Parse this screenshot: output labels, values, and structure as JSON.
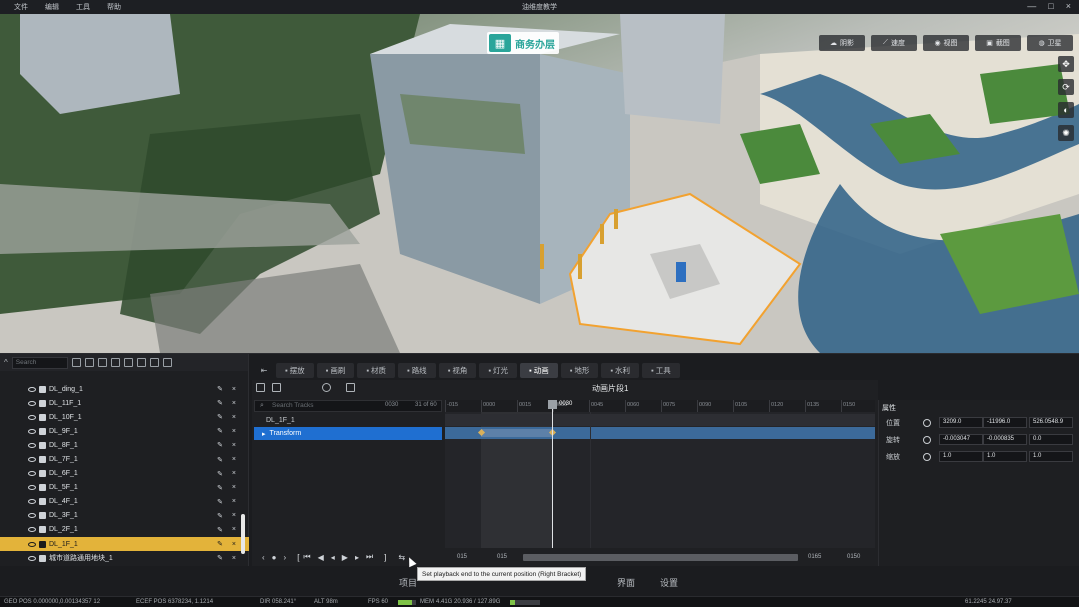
{
  "menubar": {
    "items": [
      "文件",
      "编辑",
      "工具",
      "帮助"
    ],
    "title": "油维度教学",
    "window_controls": [
      "—",
      "□",
      "×"
    ]
  },
  "viewport": {
    "floor_badge": "商务办层",
    "toolbar": [
      {
        "icon": "cloud-icon",
        "label": "阴影"
      },
      {
        "icon": "chart-icon",
        "label": "速度"
      },
      {
        "icon": "eye-icon",
        "label": "视图"
      },
      {
        "icon": "image-icon",
        "label": "截图"
      },
      {
        "icon": "globe-icon",
        "label": "卫星"
      }
    ],
    "side_buttons": [
      "move-icon",
      "rotate-icon",
      "orbit-icon",
      "compass-icon"
    ]
  },
  "tree": {
    "search_placeholder": "Search",
    "items": [
      {
        "name": "DL_ding_1",
        "selected": false
      },
      {
        "name": "DL_11F_1",
        "selected": false
      },
      {
        "name": "DL_10F_1",
        "selected": false
      },
      {
        "name": "DL_9F_1",
        "selected": false
      },
      {
        "name": "DL_8F_1",
        "selected": false
      },
      {
        "name": "DL_7F_1",
        "selected": false
      },
      {
        "name": "DL_6F_1",
        "selected": false
      },
      {
        "name": "DL_5F_1",
        "selected": false
      },
      {
        "name": "DL_4F_1",
        "selected": false
      },
      {
        "name": "DL_3F_1",
        "selected": false
      },
      {
        "name": "DL_2F_1",
        "selected": false
      },
      {
        "name": "DL_1F_1",
        "selected": true
      },
      {
        "name": "城市道路通用地块_1",
        "selected": false
      }
    ]
  },
  "tabs": {
    "items": [
      {
        "label": "摆放",
        "active": false
      },
      {
        "label": "画刷",
        "active": false
      },
      {
        "label": "材质",
        "active": false
      },
      {
        "label": "路线",
        "active": false
      },
      {
        "label": "视角",
        "active": false
      },
      {
        "label": "灯光",
        "active": false
      },
      {
        "label": "动画",
        "active": true
      },
      {
        "label": "地形",
        "active": false
      },
      {
        "label": "水利",
        "active": false
      },
      {
        "label": "工具",
        "active": false
      }
    ]
  },
  "anim": {
    "clip_name": "动画片段1",
    "search_placeholder": "Search Tracks",
    "time_code": "0030",
    "track_count": "31 of 60",
    "tracks": [
      {
        "name": "DL_1F_1",
        "selected": false
      },
      {
        "name": "Transform",
        "selected": true
      }
    ],
    "ruler": [
      "-015",
      "0000",
      "0015",
      "0030",
      "0045",
      "0060",
      "0075",
      "0090",
      "0105",
      "0120",
      "0135",
      "0150"
    ],
    "playhead_label": "0030",
    "footer": {
      "left_frame": "015",
      "left_frame2": "015",
      "right_frame": "0165",
      "right_frame2": "0150"
    }
  },
  "props": {
    "title": "属性",
    "rows": [
      {
        "label": "位置",
        "values": [
          "3209.0",
          "-11996.0",
          "526.0548.9"
        ]
      },
      {
        "label": "旋转",
        "values": [
          "-0.003047",
          "-0.000835",
          "0.0"
        ]
      },
      {
        "label": "缩放",
        "values": [
          "1.0",
          "1.0",
          "1.0"
        ]
      }
    ]
  },
  "tooltip": {
    "text": "Set playback end to the current position (Right Bracket)"
  },
  "nav": {
    "items": [
      "项目",
      "界面",
      "设置"
    ]
  },
  "status": {
    "geo_pos": "GEO POS  0.000000,0.00134357 12",
    "ecef_pos": "ECEF POS  6378234, 1.1214",
    "dir": "DIR  058.241°",
    "alt": "ALT  98m",
    "fps": "FPS  60",
    "mem_label": "MEM",
    "mem_value": "4.41G  20.936 / 127.89G",
    "right_zoom": "61.2245 24.97.37",
    "mem_level": 0.16,
    "fps_level": 0.8
  }
}
